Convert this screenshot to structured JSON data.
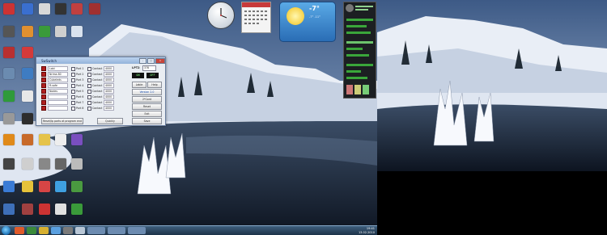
{
  "desktop_left": {
    "icon_labels": [
      "",
      "",
      "",
      "",
      "",
      "",
      "",
      "",
      "",
      "",
      "",
      "",
      "",
      "",
      "",
      "",
      "",
      "",
      "",
      ""
    ]
  },
  "gadgets": {
    "calendar": {
      "month": "",
      "day": ""
    },
    "weather": {
      "temp": "-7°",
      "range": "-7° -11°"
    }
  },
  "app": {
    "title": "SwSwitch",
    "rows": [
      {
        "name": "Lobi",
        "port": "Port 1",
        "contact": "Contact",
        "value": "4000"
      },
      {
        "name": "Nrima 80",
        "port": "Port 2",
        "contact": "Contact",
        "value": "4000"
      },
      {
        "name": "Cubeleds",
        "port": "Port 3",
        "contact": "Contact",
        "value": "4000"
      },
      {
        "name": "R-safe",
        "port": "Port 4",
        "contact": "Contact",
        "value": "4000"
      },
      {
        "name": "Nodes",
        "port": "Port 5",
        "contact": "Contact",
        "value": "4000"
      },
      {
        "name": "",
        "port": "Port 6",
        "contact": "Contact",
        "value": "4000"
      },
      {
        "name": "",
        "port": "Port 7",
        "contact": "Contact",
        "value": "4000"
      },
      {
        "name": "",
        "port": "Port 8",
        "contact": "Contact",
        "value": "4000"
      }
    ],
    "lpt_label": "LPT2",
    "lpt_value": "378",
    "lcd_a": "ON",
    "lcd_b": "OFF",
    "btn_labels": {
      "lable": "Lable",
      "help": "Help",
      "version": "Version 2.0",
      "on": "2*Cont",
      "reset": "Reset",
      "exit": "Exit"
    },
    "footer": {
      "reset_ports": "Reset/Ip ports at program end",
      "quick": "Quickly",
      "save": "Save"
    }
  },
  "taskbar": {
    "time": "19:41",
    "date": "13.02.2010"
  },
  "colors": {
    "sky": "#8fa8c8",
    "snow": "#f2f5fb",
    "water": "#1d2a3c",
    "taskbar": "#2a4560"
  }
}
